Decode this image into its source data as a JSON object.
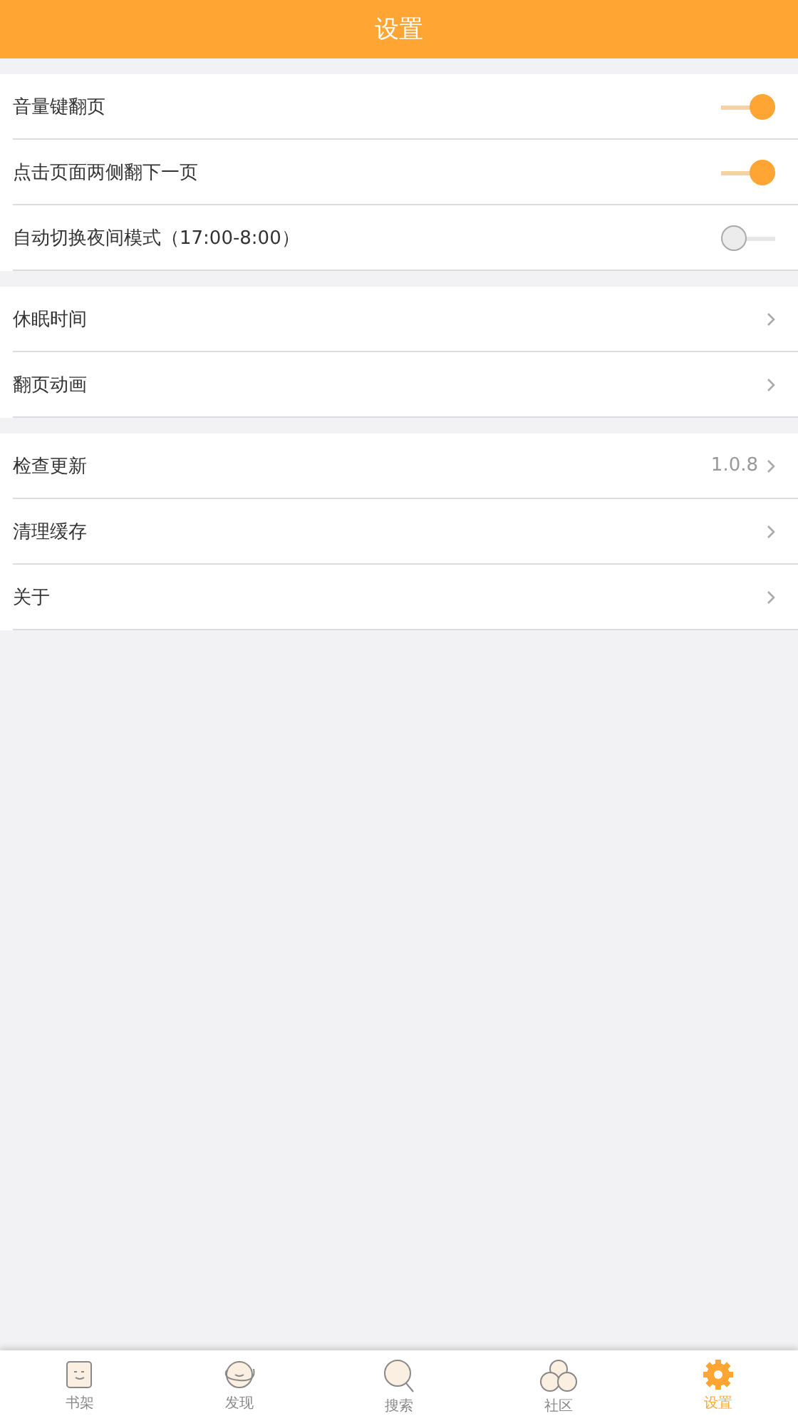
{
  "header": {
    "title": "设置"
  },
  "groups": [
    {
      "rows": [
        {
          "kind": "switch",
          "label": "音量键翻页",
          "on": true
        },
        {
          "kind": "switch",
          "label": "点击页面两侧翻下一页",
          "on": true
        },
        {
          "kind": "switch",
          "label": "自动切换夜间模式（17:00-8:00）",
          "on": false
        }
      ]
    },
    {
      "rows": [
        {
          "kind": "link",
          "label": "休眠时间"
        },
        {
          "kind": "link",
          "label": "翻页动画"
        }
      ]
    },
    {
      "rows": [
        {
          "kind": "link",
          "label": "检查更新",
          "value": "1.0.8"
        },
        {
          "kind": "link",
          "label": "清理缓存"
        },
        {
          "kind": "link",
          "label": "关于"
        }
      ]
    }
  ],
  "tabs": [
    {
      "label": "书架",
      "selected": false
    },
    {
      "label": "发现",
      "selected": false
    },
    {
      "label": "搜索",
      "selected": false
    },
    {
      "label": "社区",
      "selected": false
    },
    {
      "label": "设置",
      "selected": true
    }
  ]
}
